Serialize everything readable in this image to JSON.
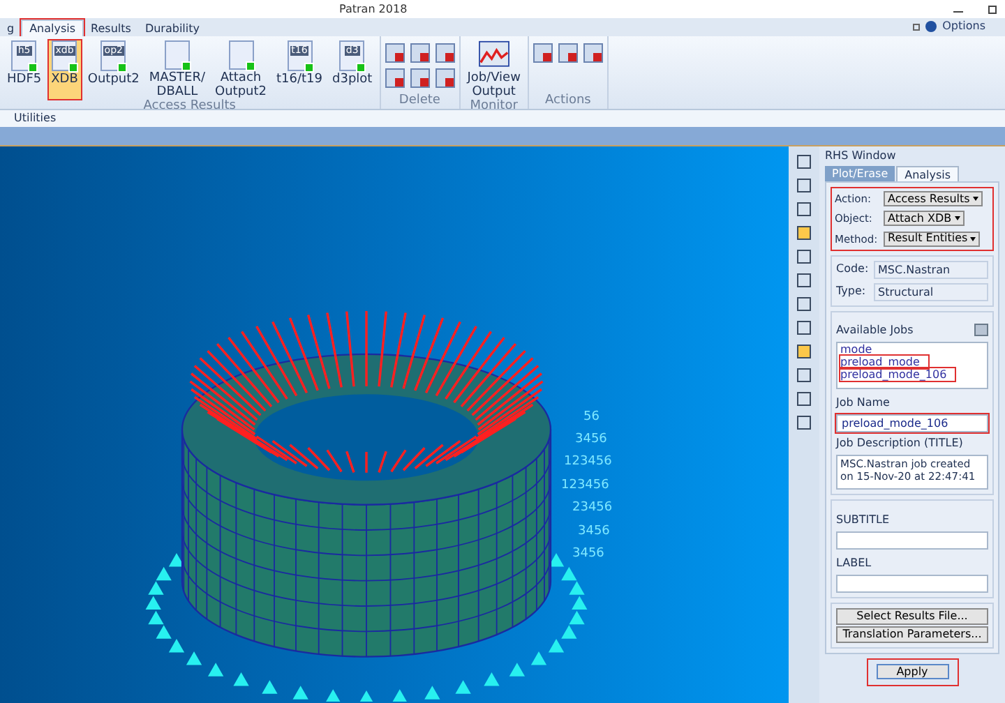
{
  "window": {
    "title": "Patran 2018",
    "options": "Options"
  },
  "tabs": [
    {
      "label": "g",
      "selected": false,
      "highlighted": false
    },
    {
      "label": "Analysis",
      "selected": true,
      "highlighted": true
    },
    {
      "label": "Results",
      "selected": false,
      "highlighted": false
    },
    {
      "label": "Durability",
      "selected": false,
      "highlighted": false
    }
  ],
  "ribbon": {
    "groups": [
      {
        "label": "Access Results",
        "buttons": [
          {
            "label": "HDF5",
            "icon": "h5",
            "selected": false,
            "highlighted": false
          },
          {
            "label": "XDB",
            "icon": "xdb",
            "selected": true,
            "highlighted": true
          },
          {
            "label": "Output2",
            "icon": "op2",
            "selected": false,
            "highlighted": false
          },
          {
            "label": "MASTER/\nDBALL",
            "selected": false,
            "highlighted": false
          },
          {
            "label": "Attach\nOutput2",
            "selected": false,
            "highlighted": false
          },
          {
            "label": "t16/t19",
            "icon": "t16",
            "selected": false,
            "highlighted": false
          },
          {
            "label": "d3plot",
            "icon": "d3",
            "selected": false,
            "highlighted": false
          }
        ]
      },
      {
        "label": "Delete"
      },
      {
        "label": "Monitor",
        "buttons": [
          {
            "label": "Job/View\nOutput",
            "selected": false,
            "highlighted": false
          }
        ]
      },
      {
        "label": "Actions"
      }
    ]
  },
  "menu": [
    {
      "label": "Utilities"
    }
  ],
  "viewport": {
    "constraint_labels": [
      "56",
      "3456",
      "123456",
      "123456",
      "23456",
      "3456",
      "3456"
    ]
  },
  "rhs": {
    "title": "RHS Window",
    "tabs": [
      {
        "label": "Plot/Erase",
        "selected": false
      },
      {
        "label": "Analysis",
        "selected": true
      }
    ],
    "selectors": [
      {
        "label": "Action:",
        "value": "Access Results"
      },
      {
        "label": "Object:",
        "value": "Attach XDB"
      },
      {
        "label": "Method:",
        "value": "Result Entities"
      }
    ],
    "info": [
      {
        "label": "Code:",
        "value": "MSC.Nastran"
      },
      {
        "label": "Type:",
        "value": "Structural"
      }
    ],
    "available_jobs": {
      "label": "Available Jobs",
      "items": [
        {
          "label": "mode",
          "highlighted": false
        },
        {
          "label": "preload_mode",
          "highlighted": true
        },
        {
          "label": "preload_mode_106",
          "highlighted": true
        }
      ]
    },
    "job_name": {
      "label": "Job Name",
      "value": "preload_mode_106"
    },
    "job_description": {
      "label": "Job Description (TITLE)",
      "value": "MSC.Nastran job created on 15-Nov-20 at 22:47:41"
    },
    "subtitle": {
      "label": "SUBTITLE"
    },
    "label_field": {
      "label": "LABEL"
    },
    "buttons": [
      {
        "label": "Select Results File..."
      },
      {
        "label": "Translation Parameters..."
      }
    ],
    "apply": {
      "label": "Apply",
      "highlighted": true
    }
  }
}
